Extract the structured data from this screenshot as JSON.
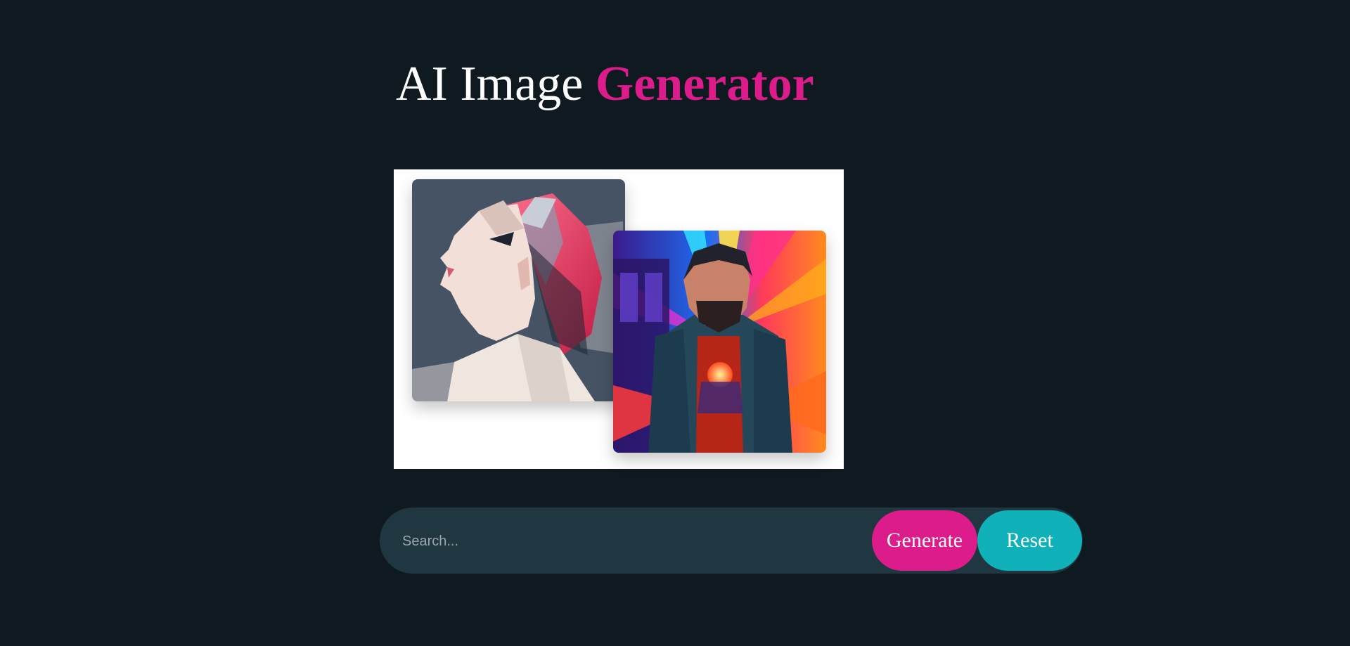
{
  "header": {
    "title_plain": "AI Image",
    "title_accent": "Generator"
  },
  "preview": {
    "images": [
      {
        "icon": "woman-profile-lowpoly-image"
      },
      {
        "icon": "man-neon-synthwave-image"
      }
    ]
  },
  "search": {
    "placeholder": "Search...",
    "value": ""
  },
  "buttons": {
    "generate_label": "Generate",
    "reset_label": "Reset"
  },
  "colors": {
    "background": "#0f1920",
    "accent": "#dd1c8b",
    "search_bar": "#203641",
    "reset": "#10b1b9"
  }
}
